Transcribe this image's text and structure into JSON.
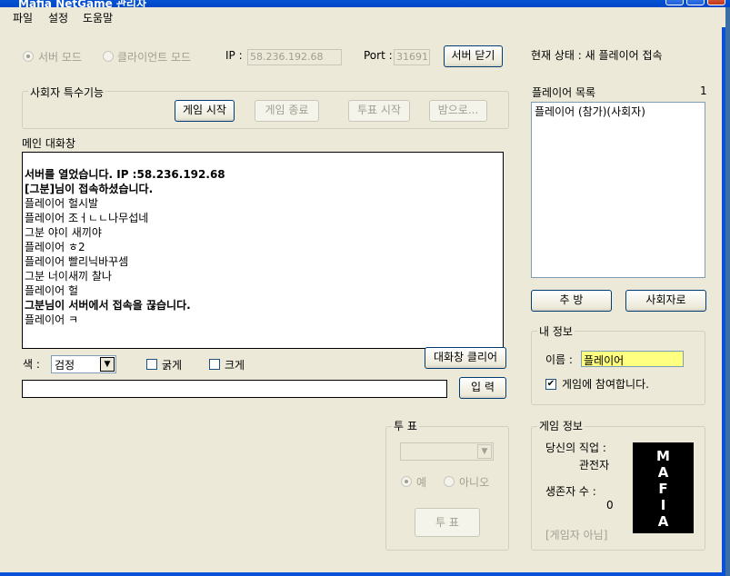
{
  "window": {
    "title": "Mafia NetGame 관리자"
  },
  "menu": {
    "items": [
      "파일",
      "설정",
      "도움말"
    ]
  },
  "server_bar": {
    "server_mode": "서버 모드",
    "client_mode": "클라이언트 모드",
    "ip_label": "IP :",
    "ip_value": "58.236.192.68",
    "port_label": "Port :",
    "port_value": "31691",
    "close_server": "서버 닫기",
    "status": "현재 상태 :  새 플레이어 접속"
  },
  "host_functions": {
    "title": "사회자 특수기능",
    "start_game": "게임 시작",
    "end_game": "게임 종료",
    "start_vote": "투표 시작",
    "night": "밤으로..."
  },
  "chat": {
    "title": "메인 대화창",
    "lines": [
      {
        "text": "서버를 열었습니다.  IP :58.236.192.68",
        "bold": true
      },
      {
        "text": "[그분]님이 접속하셨습니다.",
        "bold": true
      },
      {
        "text": "플레이어     헐시발",
        "bold": false
      },
      {
        "text": "플레이어     조ㅓㄴㄴ나무섭네",
        "bold": false
      },
      {
        "text": "그분    야이 새끼야",
        "bold": false
      },
      {
        "text": "플레이어     ㅎ2",
        "bold": false
      },
      {
        "text": "플레이어     빨리닉바꾸셈",
        "bold": false
      },
      {
        "text": "그분    너이새끼 찰나",
        "bold": false
      },
      {
        "text": "플레이어     헐",
        "bold": false
      },
      {
        "text": "그분님이 서버에서 접속을 끊습니다.",
        "bold": true
      },
      {
        "text": "플레이어     ㅋ",
        "bold": false
      }
    ],
    "clear_button": "대화창 클리어",
    "color_label": "색 :",
    "color_value": "검정",
    "bold_label": "굵게",
    "large_label": "크게",
    "input_value": "",
    "send_button": "입 력"
  },
  "vote": {
    "title": "투 표",
    "yes": "예",
    "no": "아니오",
    "vote_button": "투 표"
  },
  "players": {
    "title": "플레이어 목록",
    "count": "1",
    "items": [
      "플레이어  (참가)(사회자)"
    ],
    "kick_button": "추 방",
    "host_button": "사회자로"
  },
  "my_info": {
    "title": "내 정보",
    "name_label": "이름 :",
    "name_value": "플레이어",
    "join_label": "게임에 참여합니다.",
    "join_checked": "✔"
  },
  "game_info": {
    "title": "게임 정보",
    "job_label": "당신의 직업 :",
    "job_value": "관전자",
    "survivors_label": "생존자 수 :",
    "survivors_value": "0",
    "mafia_letters": [
      "M",
      "A",
      "F",
      "I",
      "A"
    ],
    "status": "[게임자 아님]"
  }
}
